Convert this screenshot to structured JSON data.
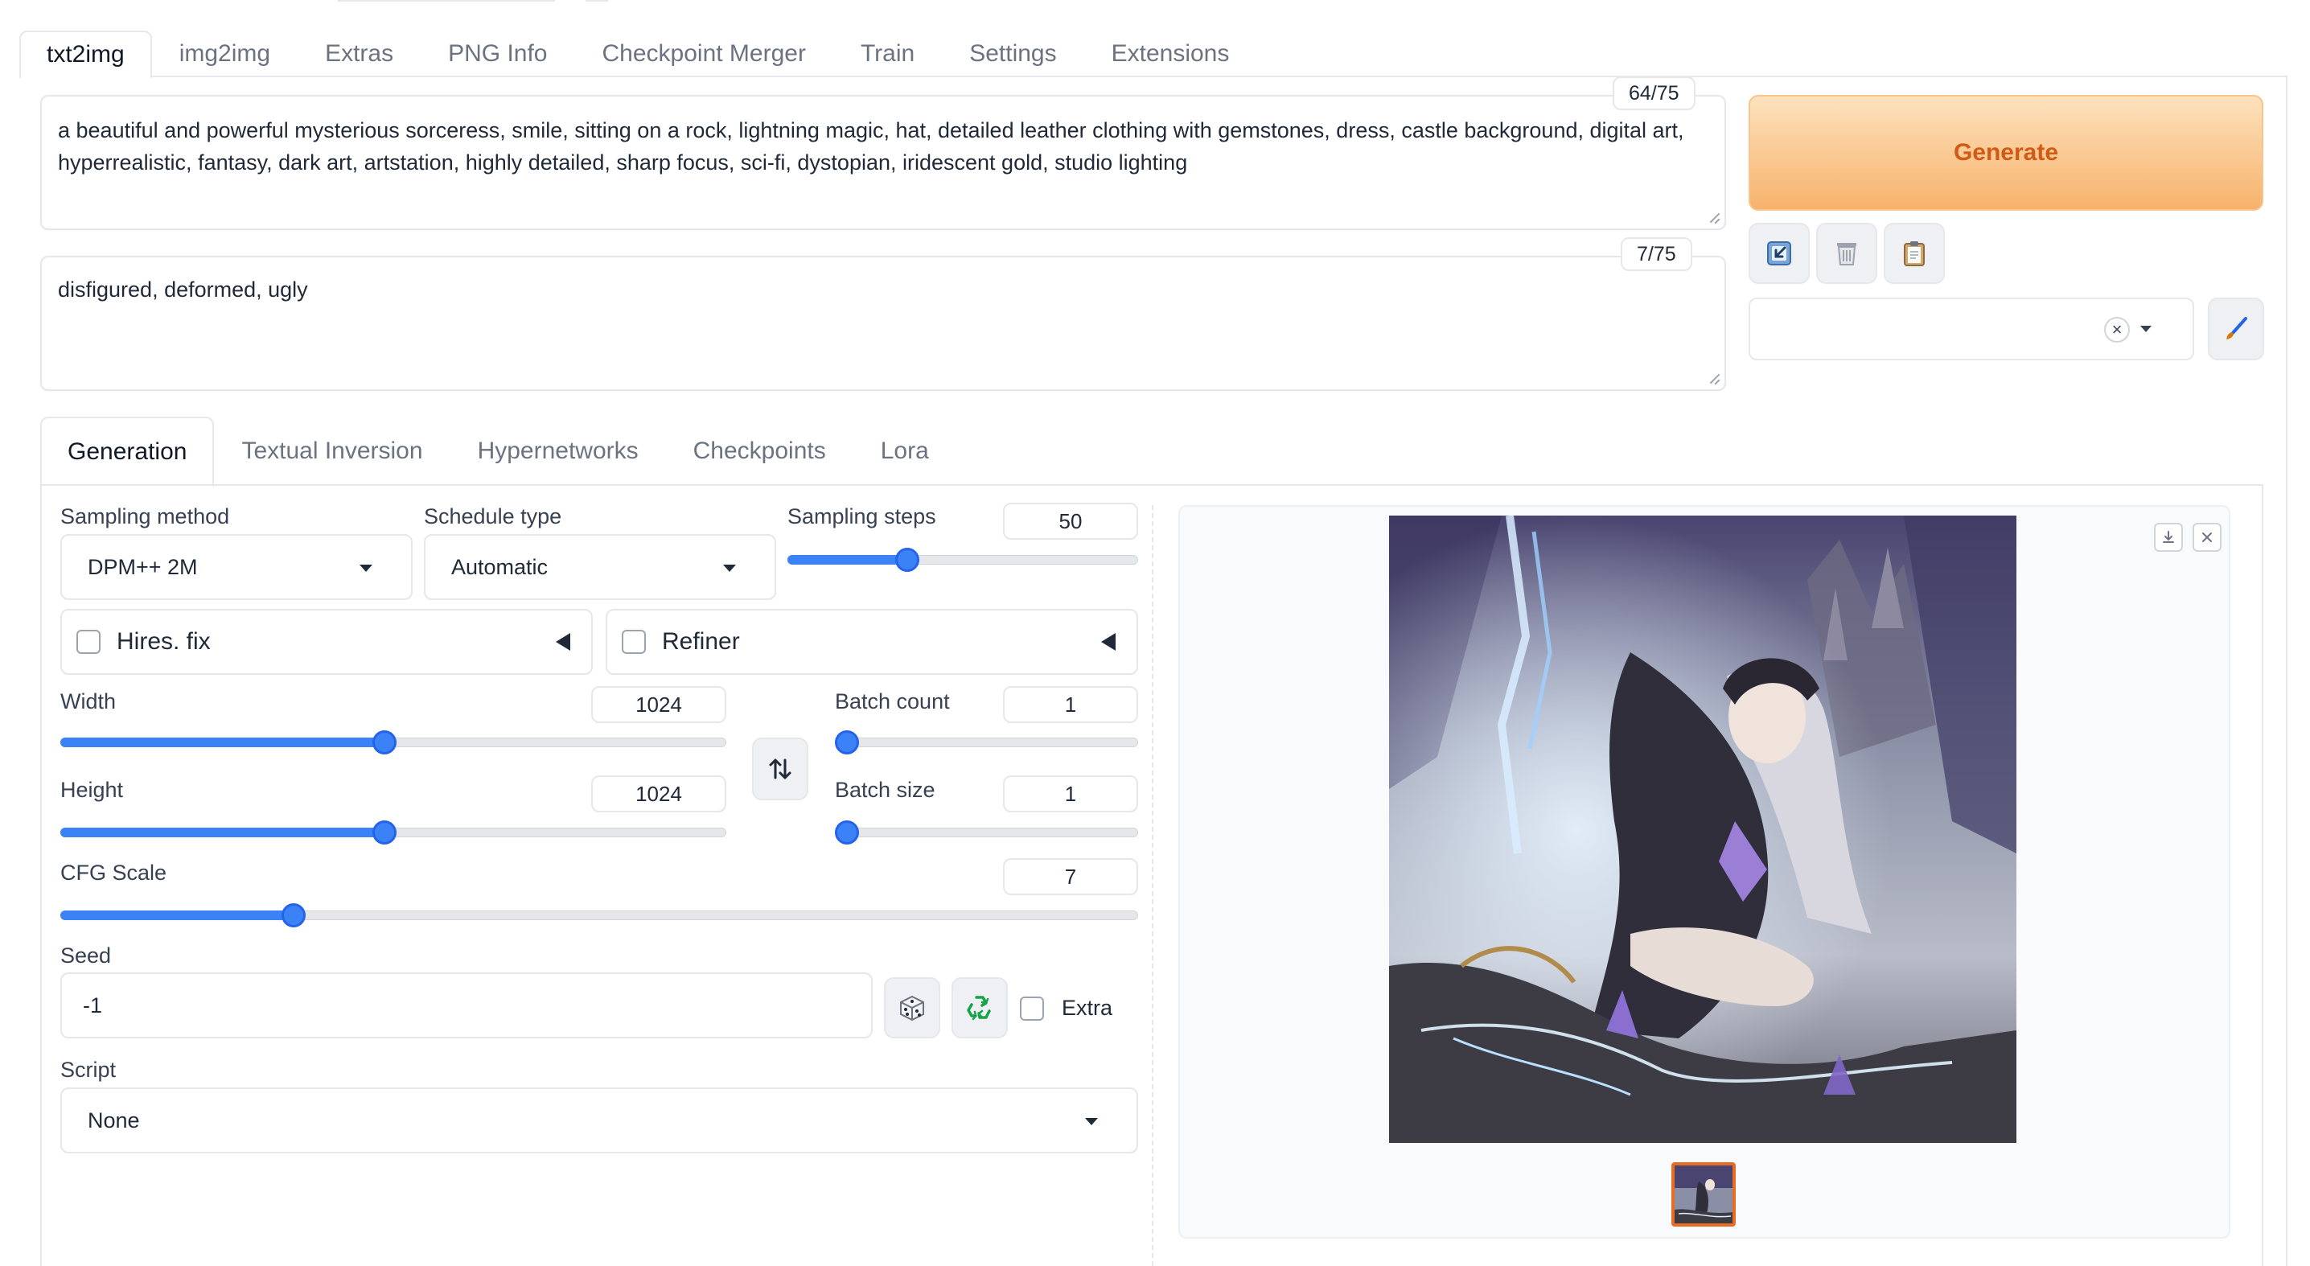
{
  "main_tabs": [
    "txt2img",
    "img2img",
    "Extras",
    "PNG Info",
    "Checkpoint Merger",
    "Train",
    "Settings",
    "Extensions"
  ],
  "prompt": {
    "positive": "a beautiful and powerful mysterious sorceress, smile, sitting on a rock, lightning magic, hat, detailed leather clothing with gemstones, dress, castle background, digital art, hyperrealistic, fantasy, dark art, artstation, highly detailed, sharp focus, sci-fi, dystopian, iridescent gold, studio lighting",
    "positive_count": "64/75",
    "negative": "disfigured, deformed, ugly",
    "negative_count": "7/75"
  },
  "actions": {
    "generate_label": "Generate"
  },
  "sub_tabs": [
    "Generation",
    "Textual Inversion",
    "Hypernetworks",
    "Checkpoints",
    "Lora"
  ],
  "generation": {
    "sampling_method_label": "Sampling method",
    "sampling_method": "DPM++ 2M",
    "schedule_type_label": "Schedule type",
    "schedule_type": "Automatic",
    "sampling_steps_label": "Sampling steps",
    "sampling_steps": "50",
    "sampling_steps_fraction": 0.33,
    "hires_fix_label": "Hires. fix",
    "refiner_label": "Refiner",
    "width_label": "Width",
    "width": "1024",
    "width_fraction": 0.486,
    "height_label": "Height",
    "height": "1024",
    "height_fraction": 0.486,
    "batch_count_label": "Batch count",
    "batch_count": "1",
    "batch_count_fraction": 0.0,
    "batch_size_label": "Batch size",
    "batch_size": "1",
    "batch_size_fraction": 0.0,
    "cfg_scale_label": "CFG Scale",
    "cfg_scale": "7",
    "cfg_scale_fraction": 0.21,
    "seed_label": "Seed",
    "seed": "-1",
    "extra_label": "Extra",
    "script_label": "Script",
    "script": "None"
  },
  "colors": {
    "accent": "#3b82f6",
    "generate_text": "#d05a16",
    "thumb_border": "#e86c24"
  }
}
